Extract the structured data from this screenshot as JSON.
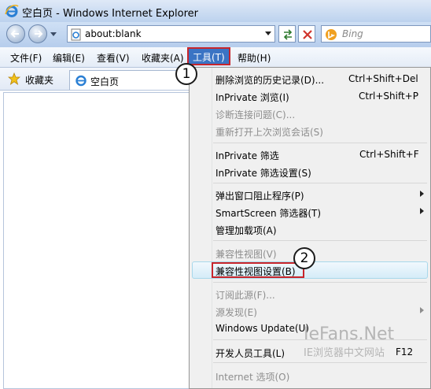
{
  "window": {
    "title": "空白页 - Windows Internet Explorer"
  },
  "address": {
    "url": "about:blank"
  },
  "search": {
    "placeholder": "Bing"
  },
  "menubar": {
    "items": [
      "文件(F)",
      "编辑(E)",
      "查看(V)",
      "收藏夹(A)",
      "工具(T)",
      "帮助(H)"
    ]
  },
  "favorites": {
    "label": "收藏夹"
  },
  "tab": {
    "label": "空白页"
  },
  "tools_menu": {
    "items": [
      {
        "label": "删除浏览的历史记录(D)...",
        "shortcut": "Ctrl+Shift+Del"
      },
      {
        "label": "InPrivate 浏览(I)",
        "shortcut": "Ctrl+Shift+P"
      },
      {
        "label": "诊断连接问题(C)..."
      },
      {
        "label": "重新打开上次浏览会话(S)"
      },
      {
        "label": "InPrivate 筛选",
        "shortcut": "Ctrl+Shift+F"
      },
      {
        "label": "InPrivate 筛选设置(S)"
      },
      {
        "label": "弹出窗口阻止程序(P)"
      },
      {
        "label": "SmartScreen 筛选器(T)"
      },
      {
        "label": "管理加载项(A)"
      },
      {
        "label": "兼容性视图(V)"
      },
      {
        "label": "兼容性视图设置(B)"
      },
      {
        "label": "订阅此源(F)..."
      },
      {
        "label": "源发现(E)"
      },
      {
        "label": "Windows Update(U)"
      },
      {
        "label": "开发人员工具(L)",
        "shortcut": "F12"
      },
      {
        "label": "Internet 选项(O)"
      }
    ]
  },
  "callouts": [
    "1",
    "2"
  ],
  "watermark": {
    "line1": "IeFans.Net",
    "line2": "IE浏览器中文网站"
  },
  "colors": {
    "menu_highlight": "#3a74c4",
    "annotation_red": "#c8252b"
  }
}
